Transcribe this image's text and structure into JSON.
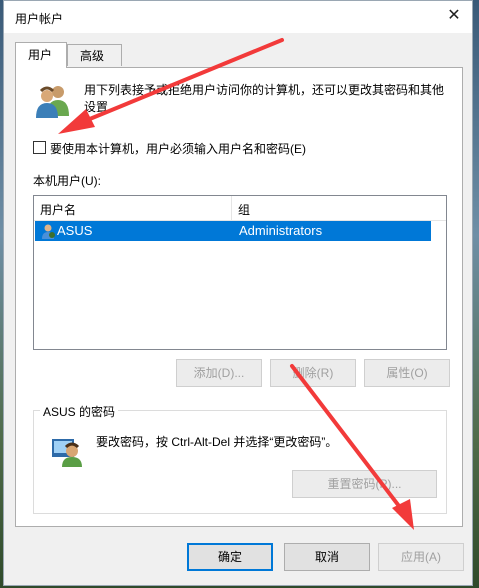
{
  "window": {
    "title": "用户帐户",
    "close_glyph": "✕"
  },
  "tabs": [
    {
      "label": "用户",
      "active": true
    },
    {
      "label": "高级",
      "active": false
    }
  ],
  "intro_text": "用下列表接予或拒绝用户访问你的计算机，还可以更改其密码和其他设置",
  "must_enter_checkbox": {
    "label": "要使用本计算机，用户必须输入用户名和密码(E)",
    "checked": false
  },
  "local_users_label": "本机用户(U):",
  "user_list": {
    "columns": [
      "用户名",
      "组"
    ],
    "rows": [
      {
        "name": "ASUS",
        "group": "Administrators",
        "selected": true
      }
    ]
  },
  "list_buttons": {
    "add": "添加(D)...",
    "remove": "删除(R)",
    "properties": "属性(O)"
  },
  "password_group": {
    "title": "ASUS 的密码",
    "text": "要改密码，按 Ctrl-Alt-Del 并选择“更改密码”。",
    "reset_button": "重置密码(P)..."
  },
  "dialog_buttons": {
    "ok": "确定",
    "cancel": "取消",
    "apply": "应用(A)"
  },
  "colors": {
    "selection": "#0078d7",
    "annotation_arrow": "#f23a3a"
  },
  "icons": [
    "close-icon",
    "users-icon",
    "user-row-icon",
    "password-user-icon"
  ]
}
